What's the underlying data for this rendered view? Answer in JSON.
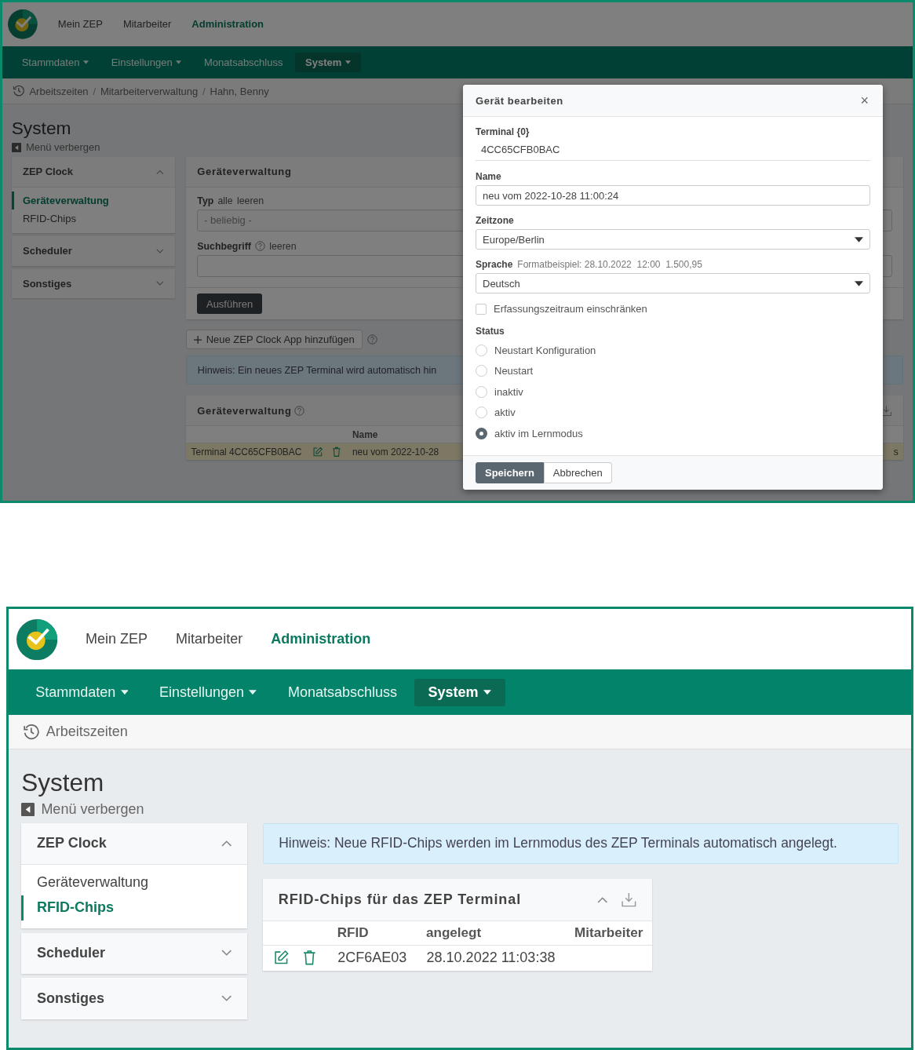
{
  "screenshots": [
    {
      "header": {
        "nav": [
          {
            "label": "Mein ZEP",
            "selected": false
          },
          {
            "label": "Mitarbeiter",
            "selected": false
          },
          {
            "label": "Administration",
            "selected": true
          }
        ]
      },
      "menubar": [
        {
          "label": "Stammdaten",
          "dropdown": true,
          "selected": false
        },
        {
          "label": "Einstellungen",
          "dropdown": true,
          "selected": false
        },
        {
          "label": "Monatsabschluss",
          "dropdown": false,
          "selected": false
        },
        {
          "label": "System",
          "dropdown": true,
          "selected": true
        }
      ],
      "breadcrumb": [
        {
          "kind": "link",
          "text": "Arbeitszeiten"
        },
        {
          "kind": "separator",
          "text": "/"
        },
        {
          "kind": "link",
          "text": "Mitarbeiterverwaltung"
        },
        {
          "kind": "separator",
          "text": "/"
        },
        {
          "kind": "link",
          "text": "Hahn, Benny"
        }
      ],
      "page_title": "System",
      "menu_toggle": "Menü verbergen",
      "sidebar": [
        {
          "title": "ZEP Clock",
          "expanded": true,
          "items": [
            {
              "label": "Geräteverwaltung",
              "selected": true
            },
            {
              "label": "RFID-Chips",
              "selected": false
            }
          ]
        },
        {
          "title": "Scheduler",
          "expanded": false
        },
        {
          "title": "Sonstiges",
          "expanded": false
        }
      ],
      "filter_panel": {
        "title": "Geräteverwaltung",
        "filters": [
          {
            "kind": "select",
            "label": "Typ",
            "help": false,
            "links": [
              "alle",
              "leeren"
            ],
            "placeholder": "- beliebig -"
          },
          {
            "kind": "text",
            "label": "Suchbegriff",
            "help": true,
            "links": [
              "leeren"
            ]
          }
        ],
        "submit": "Ausführen"
      },
      "add_button": {
        "label": "Neue ZEP Clock App hinzufügen",
        "help": true
      },
      "notice": "Hinweis: Ein neues ZEP Terminal wird automatisch hin",
      "table_panel": {
        "title": "Geräteverwaltung",
        "help": true,
        "collapsible": false,
        "exportable": true,
        "columns": [
          "",
          "",
          "Name",
          ""
        ],
        "rows": [
          {
            "highlighted": true,
            "cells": [
              {
                "kind": "text",
                "text": "Terminal 4CC65CFB0BAC"
              },
              {
                "kind": "actions"
              },
              {
                "kind": "text",
                "text": "neu vom 2022-10-28"
              },
              {
                "kind": "text",
                "text": "s"
              }
            ]
          }
        ]
      },
      "dialog": {
        "title": "Gerät bearbeiten",
        "close": "×",
        "fields": [
          {
            "kind": "static",
            "label": "Terminal {0}",
            "value": "4CC65CFB0BAC"
          },
          {
            "kind": "text",
            "label": "Name",
            "value": "neu vom 2022-10-28 11:00:24"
          },
          {
            "kind": "select",
            "label": "Zeitzone",
            "value": "Europe/Berlin"
          },
          {
            "kind": "select",
            "label": "Sprache",
            "hint": "Formatbeispiel: 28.10.2022  12:00  1.500,95",
            "value": "Deutsch"
          },
          {
            "kind": "checkbox",
            "label": "Erfassungszeitraum einschränken",
            "checked": false
          },
          {
            "kind": "radio_group",
            "label": "Status",
            "options": [
              {
                "label": "Neustart Konfiguration",
                "selected": false
              },
              {
                "label": "Neustart",
                "selected": false
              },
              {
                "label": "inaktiv",
                "selected": false
              },
              {
                "label": "aktiv",
                "selected": false
              },
              {
                "label": "aktiv im Lernmodus",
                "selected": true
              }
            ]
          }
        ],
        "buttons": [
          {
            "label": "Speichern",
            "primary": true
          },
          {
            "label": "Abbrechen",
            "primary": false
          }
        ]
      }
    },
    {
      "header": {
        "nav": [
          {
            "label": "Mein ZEP",
            "selected": false
          },
          {
            "label": "Mitarbeiter",
            "selected": false
          },
          {
            "label": "Administration",
            "selected": true
          }
        ]
      },
      "menubar": [
        {
          "label": "Stammdaten",
          "dropdown": true,
          "selected": false
        },
        {
          "label": "Einstellungen",
          "dropdown": true,
          "selected": false
        },
        {
          "label": "Monatsabschluss",
          "dropdown": false,
          "selected": false
        },
        {
          "label": "System",
          "dropdown": true,
          "selected": true
        }
      ],
      "breadcrumb": [
        {
          "kind": "link",
          "text": "Arbeitszeiten"
        }
      ],
      "page_title": "System",
      "menu_toggle": "Menü verbergen",
      "sidebar": [
        {
          "title": "ZEP Clock",
          "expanded": true,
          "items": [
            {
              "label": "Geräteverwaltung",
              "selected": false
            },
            {
              "label": "RFID-Chips",
              "selected": true
            }
          ]
        },
        {
          "title": "Scheduler",
          "expanded": false
        },
        {
          "title": "Sonstiges",
          "expanded": false
        }
      ],
      "notice": "Hinweis: Neue RFID-Chips werden im Lernmodus des ZEP Terminals automatisch angelegt.",
      "table_panel": {
        "title": "RFID-Chips für das ZEP Terminal",
        "help": false,
        "collapsible": true,
        "exportable": true,
        "columns": [
          "",
          "RFID",
          "angelegt",
          "Mitarbeiter"
        ],
        "rows": [
          {
            "highlighted": false,
            "cells": [
              {
                "kind": "actions"
              },
              {
                "kind": "text",
                "text": "2CF6AE03"
              },
              {
                "kind": "text",
                "text": "28.10.2022 11:03:38"
              },
              {
                "kind": "empty"
              }
            ]
          }
        ]
      }
    }
  ]
}
